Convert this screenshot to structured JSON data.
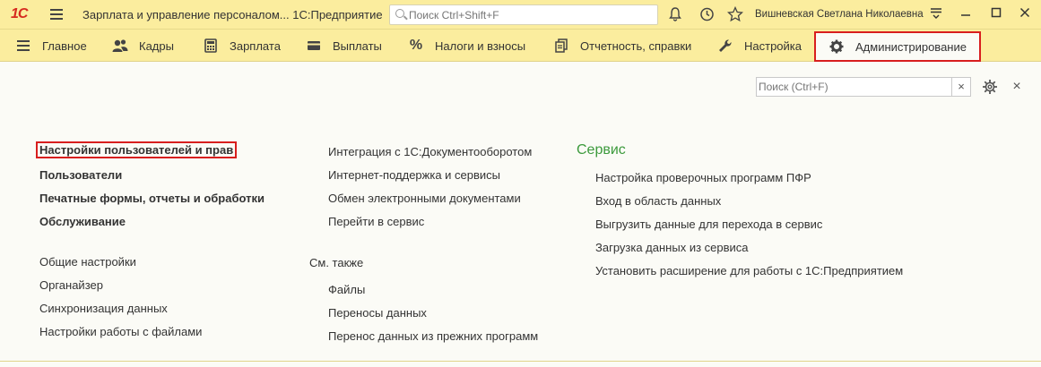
{
  "titlebar": {
    "logo": "1С",
    "title": "Зарплата и управление персоналом... 1С:Предприятие",
    "search_placeholder": "Поиск Ctrl+Shift+F",
    "user": "Вишневская Светлана Николаевна"
  },
  "sections": [
    {
      "label": "Главное",
      "icon": "menu-icon"
    },
    {
      "label": "Кадры",
      "icon": "people-icon"
    },
    {
      "label": "Зарплата",
      "icon": "calculator-icon"
    },
    {
      "label": "Выплаты",
      "icon": "wallet-icon"
    },
    {
      "label": "Налоги и взносы",
      "icon": "percent-icon"
    },
    {
      "label": "Отчетность, справки",
      "icon": "reports-icon"
    },
    {
      "label": "Настройка",
      "icon": "wrench-icon"
    },
    {
      "label": "Администрирование",
      "icon": "gear-icon",
      "active": true
    }
  ],
  "content": {
    "search_placeholder": "Поиск (Ctrl+F)",
    "col1_bold": [
      "Настройки пользователей и прав",
      "Пользователи",
      "Печатные формы, отчеты и обработки",
      "Обслуживание"
    ],
    "col1_normal": [
      "Общие настройки",
      "Органайзер",
      "Синхронизация данных",
      "Настройки работы с файлами"
    ],
    "col2_top": [
      "Интеграция с 1С:Документооборотом",
      "Интернет-поддержка и сервисы",
      "Обмен электронными документами",
      "Перейти в сервис"
    ],
    "col2_see_also_title": "См. также",
    "col2_see_also": [
      "Файлы",
      "Переносы данных",
      "Перенос данных из прежних программ"
    ],
    "col3_title": "Сервис",
    "col3_items": [
      "Настройка проверочных программ ПФР",
      "Вход в область данных",
      "Выгрузить данные для перехода в сервис",
      "Загрузка данных из сервиса",
      "Установить расширение для работы с 1С:Предприятием"
    ]
  },
  "colors": {
    "bar": "#fbed9e",
    "highlight": "#d81e1e",
    "group_title": "#3c9a3c"
  }
}
